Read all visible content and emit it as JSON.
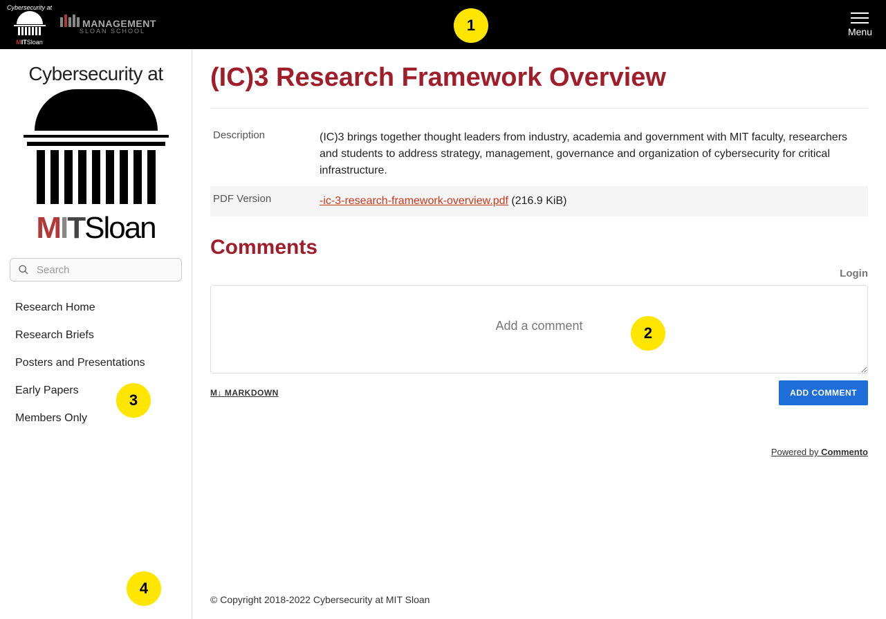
{
  "header": {
    "small_logo_top": "Cybersecurity at",
    "small_mit_m": "M",
    "small_mit_it": "IT",
    "small_mit_sloan": "Sloan",
    "mgmt_text": "MANAGEMENT",
    "mgmt_sub": "SLOAN SCHOOL",
    "menu_label": "Menu"
  },
  "sidebar": {
    "big_logo_top": "Cybersecurity at",
    "big_mit_m": "M",
    "big_mit_i": "I",
    "big_mit_t": "T",
    "big_mit_sloan": "Sloan",
    "search_placeholder": "Search",
    "nav": [
      {
        "label": "Research Home"
      },
      {
        "label": "Research Briefs"
      },
      {
        "label": "Posters and Presentations"
      },
      {
        "label": "Early Papers"
      },
      {
        "label": "Members Only"
      }
    ]
  },
  "main": {
    "title": "(IC)3 Research Framework Overview",
    "meta": {
      "description_label": "Description",
      "description_value": "(IC)3 brings together thought leaders from industry, academia and government with MIT faculty, researchers and students to address strategy, management, governance and organization of cybersecurity for critical infrastructure.",
      "pdf_label": "PDF Version",
      "pdf_filename": "-ic-3-research-framework-overview.pdf",
      "pdf_size": " (216.9 KiB)"
    },
    "comments": {
      "heading": "Comments",
      "login": "Login",
      "placeholder": "Add a comment",
      "markdown_icon": "M↓",
      "markdown_label": "  MARKDOWN",
      "add_button": "ADD COMMENT",
      "powered_prefix": "Powered by ",
      "powered_name": "Commento"
    },
    "footer": "© Copyright 2018-2022 Cybersecurity at MIT Sloan"
  },
  "markers": {
    "m1": "1",
    "m2": "2",
    "m3": "3",
    "m4": "4"
  }
}
